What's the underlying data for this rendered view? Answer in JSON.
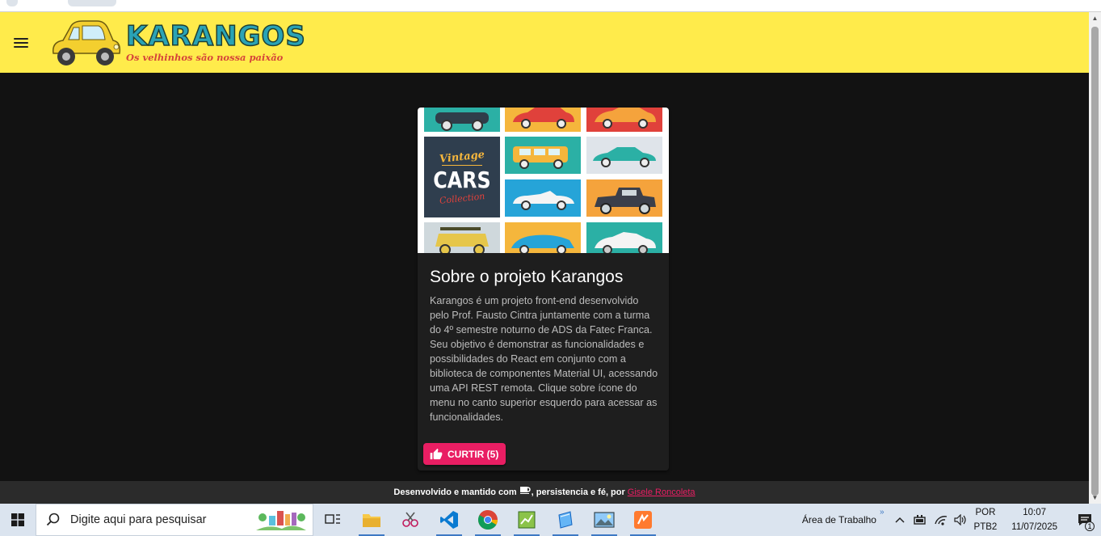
{
  "app": {
    "logo_title": "KARANGOS",
    "logo_subtitle": "Os velhinhos são nossa paixão",
    "menu_icon": "hamburger-menu-icon"
  },
  "card": {
    "image_text_vintage": "Vintage",
    "image_text_cars": "CARS",
    "image_text_collection": "Collection",
    "title": "Sobre o projeto Karangos",
    "body": "Karangos é um projeto front-end desenvolvido pelo Prof. Fausto Cintra juntamente com a turma do 4º semestre noturno de ADS da Fatec Franca. Seu objetivo é demonstrar as funcionalidades e possibilidades do React em conjunto com a biblioteca de componentes Material UI, acessando uma API REST remota. Clique sobre ícone do menu no canto superior esquerdo para acessar as funcionalidades.",
    "like_label": "CURTIR (5)"
  },
  "footer": {
    "text_before": "Desenvolvido e mantido com",
    "text_after": ", persistencia e fé, por",
    "author_link": "Gisele Roncoleta"
  },
  "taskbar": {
    "search_placeholder": "Digite aqui para pesquisar",
    "desktop_label": "Área de Trabalho",
    "language_top": "POR",
    "language_bottom": "PTB2",
    "time": "10:07",
    "date": "11/07/2025",
    "notification_count": "1"
  },
  "colors": {
    "appbar": "#ffeb4b",
    "accent_pink": "#e91e63",
    "background": "#121212",
    "card": "#1e1e1e"
  }
}
